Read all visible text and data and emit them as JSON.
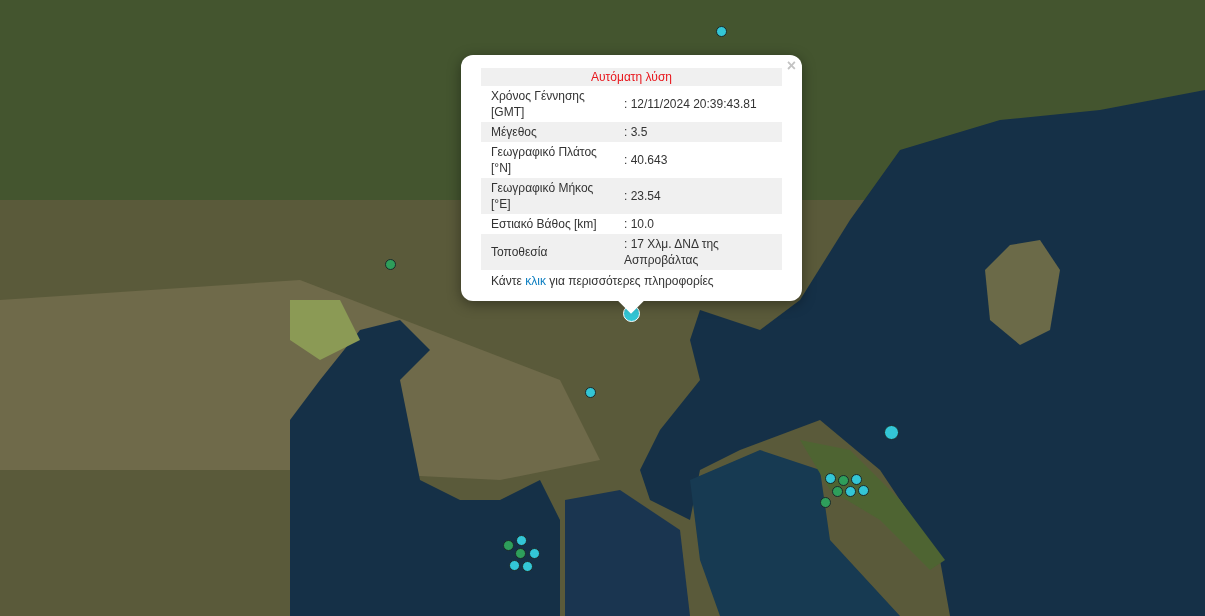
{
  "popup": {
    "title": "Αυτόματη λύση",
    "close": "×",
    "rows": [
      {
        "label": "Χρόνος Γέννησης [GMT]",
        "value": ": 12/11/2024 20:39:43.81"
      },
      {
        "label": "Μέγεθος",
        "value": ": 3.5"
      },
      {
        "label": "Γεωγραφικό Πλάτος [°N]",
        "value": ": 40.643"
      },
      {
        "label": "Γεωγραφικό Μήκος [°E]",
        "value": ": 23.54"
      },
      {
        "label": "Εστιακό Βάθος [km]",
        "value": ": 10.0"
      },
      {
        "label": "Τοποθεσία",
        "value": ": 17 Χλμ. ΔΝΔ της Ασπροβάλτας"
      }
    ],
    "footer": {
      "before": "Κάντε",
      "link": "κλικ",
      "after": "για περισσότερες πληροφορίες"
    }
  },
  "markers": [
    {
      "color": "#33c6d6",
      "kind": "small",
      "selected": false
    },
    {
      "color": "#2e9e5b",
      "kind": "small",
      "selected": false
    },
    {
      "color": "#33c6d6",
      "kind": "large",
      "selected": true
    },
    {
      "color": "#33c6d6",
      "kind": "small",
      "selected": false
    },
    {
      "color": "#33c6d6",
      "kind": "large",
      "selected": false
    },
    {
      "color": "#2e9e5b",
      "kind": "small",
      "selected": false
    },
    {
      "color": "#33c6d6",
      "kind": "small",
      "selected": false
    },
    {
      "color": "#2e9e5b",
      "kind": "small",
      "selected": false
    },
    {
      "color": "#33c6d6",
      "kind": "small",
      "selected": false
    },
    {
      "color": "#33c6d6",
      "kind": "small",
      "selected": false
    },
    {
      "color": "#33c6d6",
      "kind": "small",
      "selected": false
    },
    {
      "color": "#33c6d6",
      "kind": "small",
      "selected": false
    },
    {
      "color": "#2e9e5b",
      "kind": "small",
      "selected": false
    },
    {
      "color": "#2e9e5b",
      "kind": "small",
      "selected": false
    },
    {
      "color": "#33c6d6",
      "kind": "small",
      "selected": false
    },
    {
      "color": "#33c6d6",
      "kind": "small",
      "selected": false
    },
    {
      "color": "#33c6d6",
      "kind": "small",
      "selected": false
    },
    {
      "color": "#2e9e5b",
      "kind": "small",
      "selected": false
    }
  ]
}
